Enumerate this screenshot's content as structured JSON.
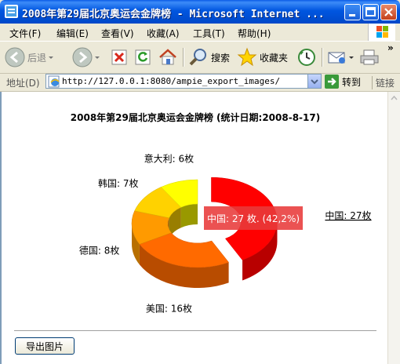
{
  "window": {
    "title": "2008年第29届北京奥运会金牌榜 - Microsoft Internet ..."
  },
  "menu": {
    "items": [
      "文件(F)",
      "编辑(E)",
      "查看(V)",
      "收藏(A)",
      "工具(T)",
      "帮助(H)"
    ]
  },
  "toolbar": {
    "back_label": "后退",
    "search_label": "搜索",
    "favorites_label": "收藏夹",
    "more": "»"
  },
  "address": {
    "label": "地址(D)",
    "url": "http://127.0.0.1:8080/ampie_export_images/",
    "go_label": "转到",
    "links_label": "链接"
  },
  "chart_data": {
    "type": "pie",
    "title": "2008年第29届北京奥运会金牌榜 (统计日期:2008-8-17)",
    "slices": [
      {
        "label": "中国: 27枚",
        "value": 27,
        "color": "#ff0000"
      },
      {
        "label": "美国: 16枚",
        "value": 16,
        "color": "#ff6a00"
      },
      {
        "label": "德国: 8枚",
        "value": 8,
        "color": "#ff9a00"
      },
      {
        "label": "韩国: 7枚",
        "value": 7,
        "color": "#ffd200"
      },
      {
        "label": "意大利: 6枚",
        "value": 6,
        "color": "#ffff00"
      }
    ],
    "tooltip": "中国: 27 枚. (42,2%)",
    "legend": "right",
    "legend_entry": "中国: 27枚"
  },
  "export_button": "导出图片"
}
